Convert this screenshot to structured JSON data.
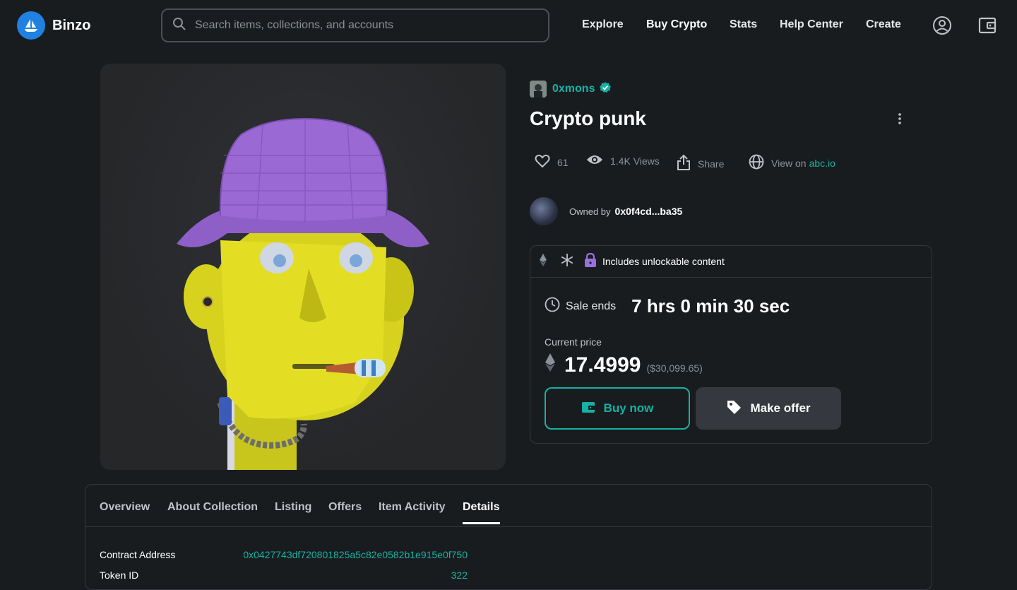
{
  "app": {
    "name": "Binzo"
  },
  "search": {
    "placeholder": "Search items, collections, and accounts"
  },
  "nav": {
    "items": [
      "Explore",
      "Buy Crypto",
      "Stats",
      "Help Center",
      "Create"
    ]
  },
  "item": {
    "creator": "0xmons",
    "title": "Crypto punk",
    "likes": "61",
    "views": "1.4K Views",
    "share_label": "Share",
    "view_on_prefix": "View on",
    "view_on_link": "abc.io",
    "owner_label": "Owned by",
    "owner_address": "0x0f4cd...ba35"
  },
  "sale": {
    "unlockable_text": "Includes unlockable content",
    "ends_label": "Sale ends",
    "countdown": "7 hrs 0 min 30 sec",
    "price_label": "Current price",
    "price": "17.4999",
    "price_usd": "($30,099.65)",
    "buy_label": "Buy now",
    "offer_label": "Make offer"
  },
  "tabs": {
    "items": [
      "Overview",
      "About Collection",
      "Listing",
      "Offers",
      "Item Activity",
      "Details"
    ],
    "active": "Details"
  },
  "details": [
    {
      "key": "Contract Address",
      "value": "0x0427743df720801825a5c82e0582b1e915e0f750"
    },
    {
      "key": "Token ID",
      "value": "322"
    }
  ],
  "colors": {
    "background": "#191c1f",
    "accent": "#15b2a5",
    "brand": "#2081e2"
  }
}
